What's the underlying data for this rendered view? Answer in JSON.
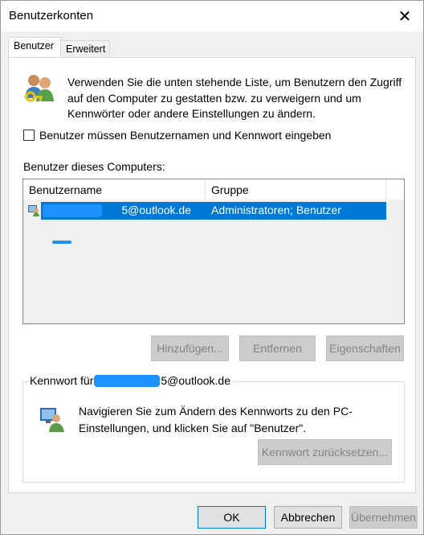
{
  "window": {
    "title": "Benutzerkonten",
    "close_glyph": "✕"
  },
  "tabs": [
    {
      "label": "Benutzer",
      "active": true
    },
    {
      "label": "Erweitert",
      "active": false
    }
  ],
  "intro": {
    "icon": "users-key-icon",
    "text": "Verwenden Sie die unten stehende Liste, um Benutzern den Zugriff auf den Computer zu gestatten bzw. zu verweigern und um Kennwörter oder andere Einstellungen zu ändern."
  },
  "require_login": {
    "label": "Benutzer müssen Benutzernamen und Kennwort eingeben",
    "checked": false
  },
  "users": {
    "label": "Benutzer dieses Computers:",
    "columns": [
      "Benutzername",
      "Gruppe"
    ],
    "rows": [
      {
        "username_visible": "5@outlook.de",
        "group": "Administratoren; Benutzer",
        "selected": true
      }
    ]
  },
  "user_buttons": {
    "add": "Hinzufügen...",
    "remove": "Entfernen",
    "properties": "Eigenschaften"
  },
  "password_group": {
    "legend_prefix": "Kennwort für ",
    "legend_suffix": "5@outlook.de",
    "text": "Navigieren Sie zum Ändern des Kennworts zu den PC-Einstellungen, und klicken Sie auf \"Benutzer\".",
    "reset_button": "Kennwort zurücksetzen..."
  },
  "footer": {
    "ok": "OK",
    "cancel": "Abbrechen",
    "apply": "Übernehmen"
  },
  "colors": {
    "selection": "#0078d7",
    "redaction": "#1e90ff",
    "dialog_bg": "#f0f0f0"
  }
}
